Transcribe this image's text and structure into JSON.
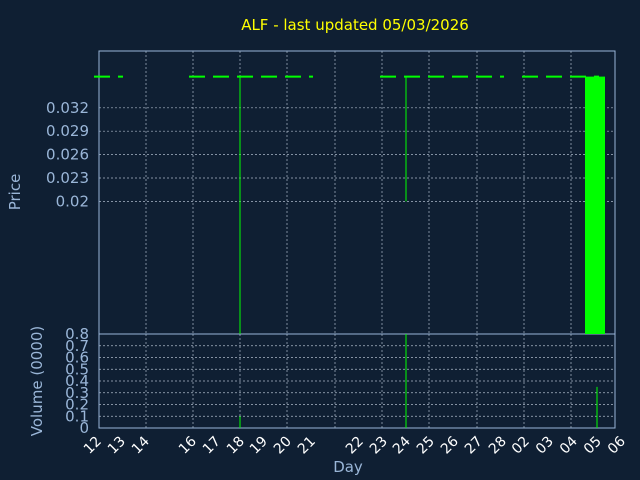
{
  "chart_data": {
    "type": "candlestick",
    "title": "ALF - last updated 05/03/2026",
    "xlabel": "Day",
    "price_ylabel": "Price",
    "volume_ylabel": "Volume (0000)",
    "x_ticks": [
      "12",
      "13",
      "14",
      "16",
      "17",
      "18",
      "19",
      "20",
      "21",
      "22",
      "23",
      "24",
      "25",
      "26",
      "27",
      "28",
      "02",
      "03",
      "04",
      "05",
      "06"
    ],
    "price_ticks": [
      "0.032",
      "0.029",
      "0.026",
      "0.023",
      "0.02"
    ],
    "price_tick_values": [
      0.032,
      0.029,
      0.026,
      0.023,
      0.02
    ],
    "volume_ticks": [
      "0.8",
      "0.7",
      "0.6",
      "0.5",
      "0.4",
      "0.3",
      "0.2",
      "0.1",
      "0"
    ],
    "volume_tick_values": [
      0.8,
      0.7,
      0.6,
      0.5,
      0.4,
      0.3,
      0.2,
      0.1,
      0
    ],
    "price_ylim": [
      0.003,
      0.038
    ],
    "volume_ylim": [
      0,
      0.8
    ],
    "colors": {
      "price": "#00ff00",
      "title": "#ffff00",
      "axis": "#9ab6d8",
      "background": "#0f1f33"
    },
    "price_level_segments": [
      {
        "from": "12",
        "to": "13",
        "y": 0.036
      },
      {
        "from": "16",
        "to": "21",
        "y": 0.036
      },
      {
        "from": "23",
        "to": "28",
        "y": 0.036
      },
      {
        "from": "02",
        "to": "05",
        "y": 0.036
      }
    ],
    "price_wicks": [
      {
        "x": "18",
        "high": 0.036,
        "low": 0.003
      },
      {
        "x": "24",
        "high": 0.036,
        "low": 0.02
      }
    ],
    "price_candles": [
      {
        "x": "05",
        "open": 0.036,
        "close": 0.003
      }
    ],
    "volume_bars": [
      {
        "x": "18",
        "value": 0.1
      },
      {
        "x": "24",
        "value": 0.8
      },
      {
        "x": "05",
        "value": 0.35
      }
    ]
  }
}
